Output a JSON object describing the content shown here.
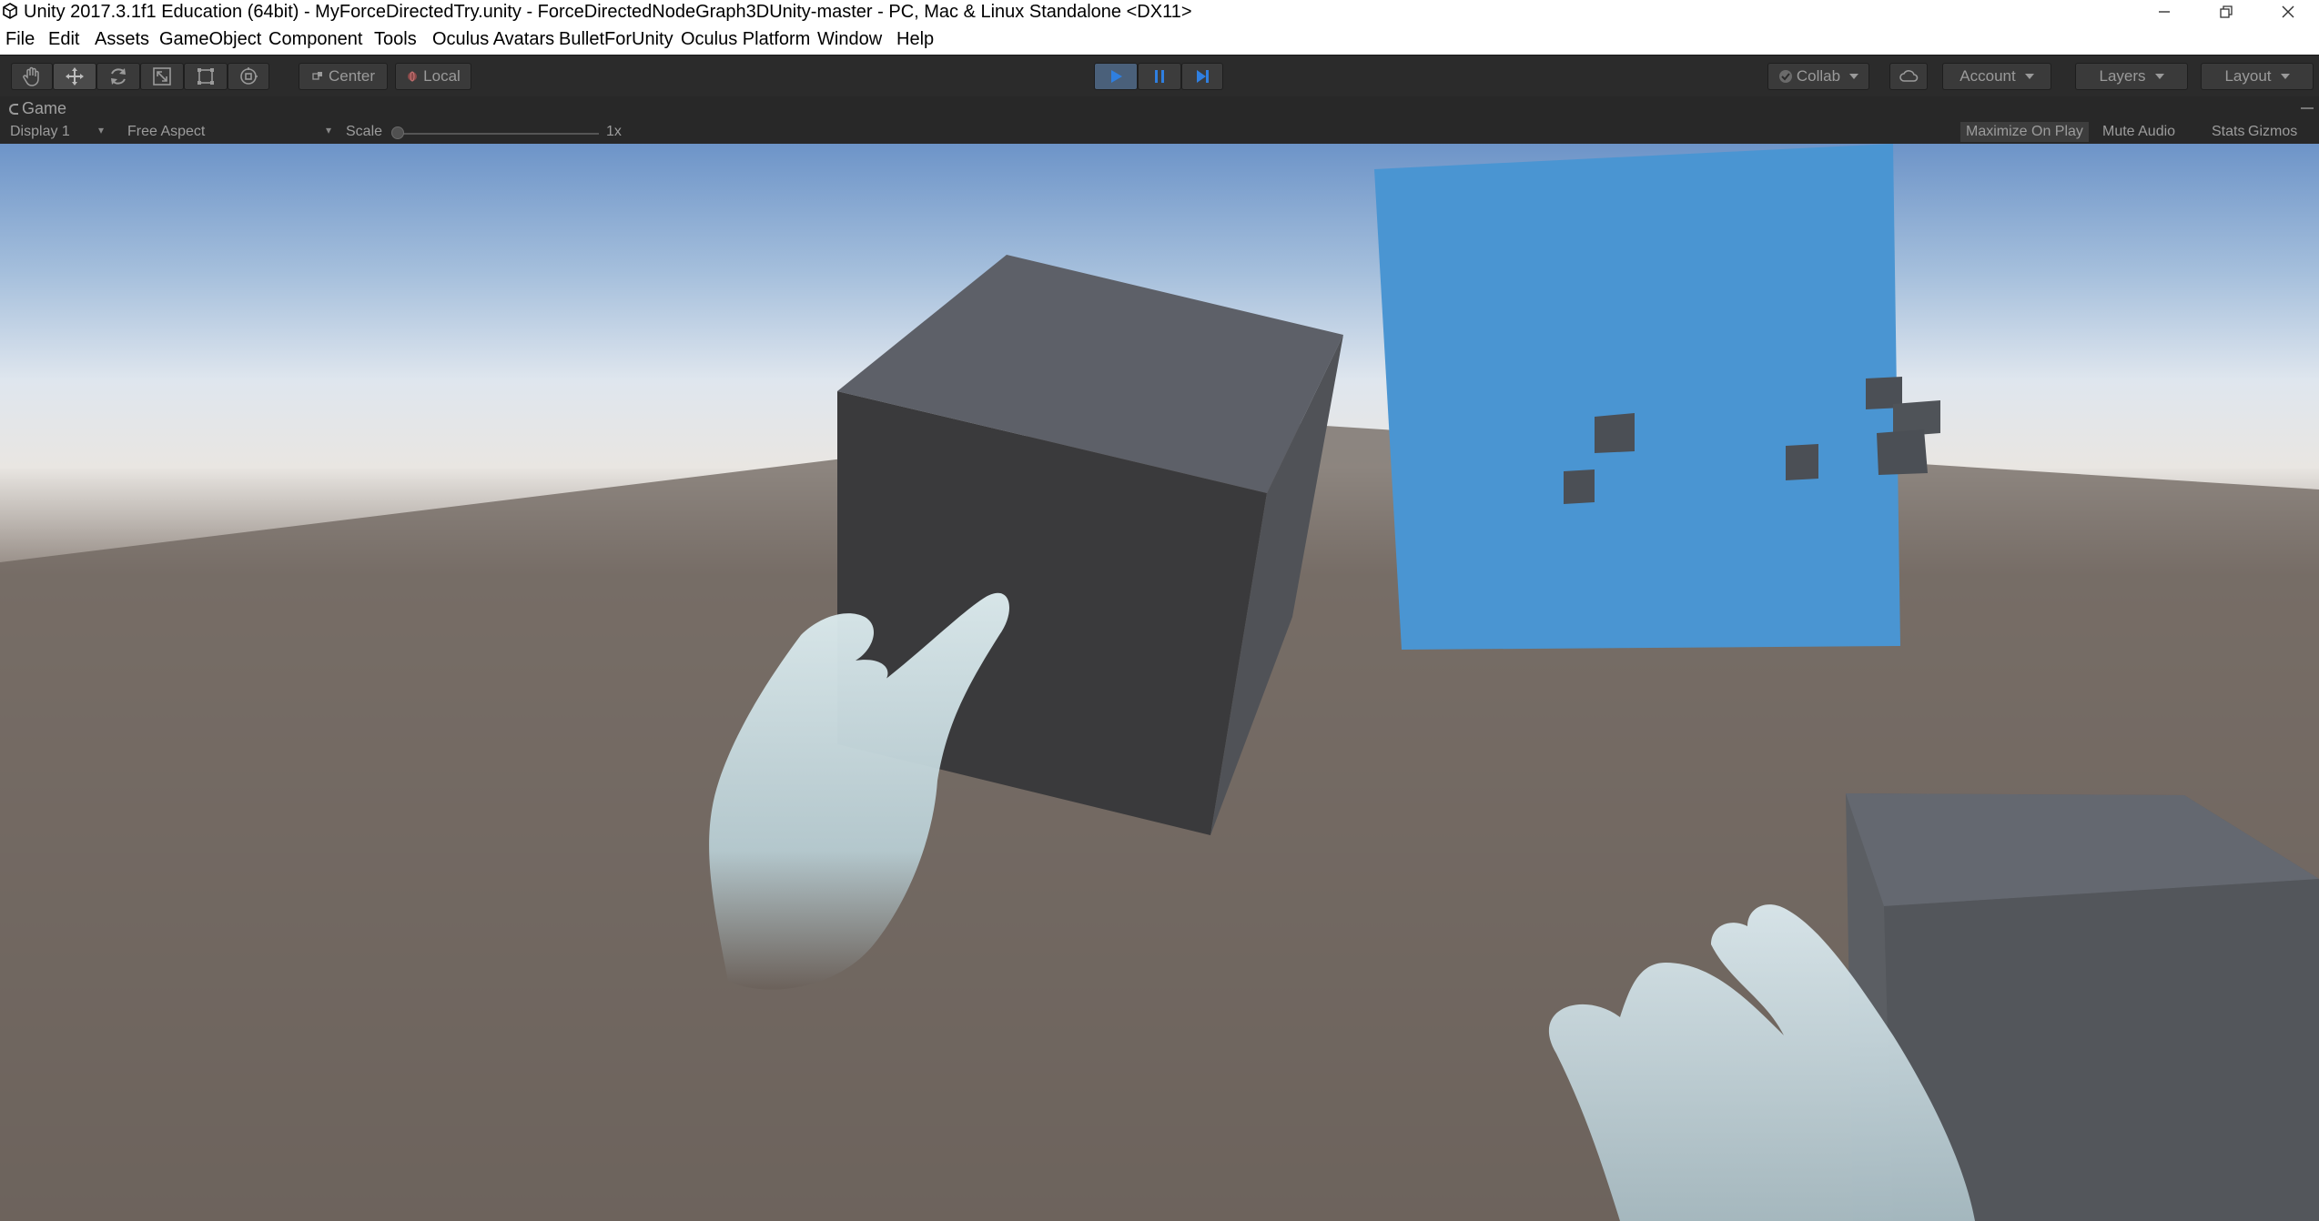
{
  "window": {
    "title": "Unity 2017.3.1f1 Education (64bit) - MyForceDirectedTry.unity - ForceDirectedNodeGraph3DUnity-master - PC, Mac & Linux Standalone <DX11>"
  },
  "menu": {
    "items": [
      "File",
      "Edit",
      "Assets",
      "GameObject",
      "Component",
      "Tools",
      "Oculus Avatars",
      "BulletForUnity",
      "Oculus Platform",
      "Window",
      "Help"
    ]
  },
  "toolbar": {
    "pivot_label": "Center",
    "space_label": "Local",
    "collab_label": "Collab",
    "account_label": "Account",
    "layers_label": "Layers",
    "layout_label": "Layout"
  },
  "game_panel": {
    "tab_label": "Game",
    "display_label": "Display 1",
    "aspect_label": "Free Aspect",
    "scale_label": "Scale",
    "scale_value": "1x",
    "maximize_label": "Maximize On Play",
    "mute_label": "Mute Audio",
    "stats_label": "Stats",
    "gizmos_label": "Gizmos"
  },
  "colors": {
    "toolbar_bg": "#2b2b2b",
    "play_active": "#4a607a",
    "sky_top": "#6d94c8",
    "ground": "#6b615a",
    "panel_blue": "#4a95d2"
  }
}
